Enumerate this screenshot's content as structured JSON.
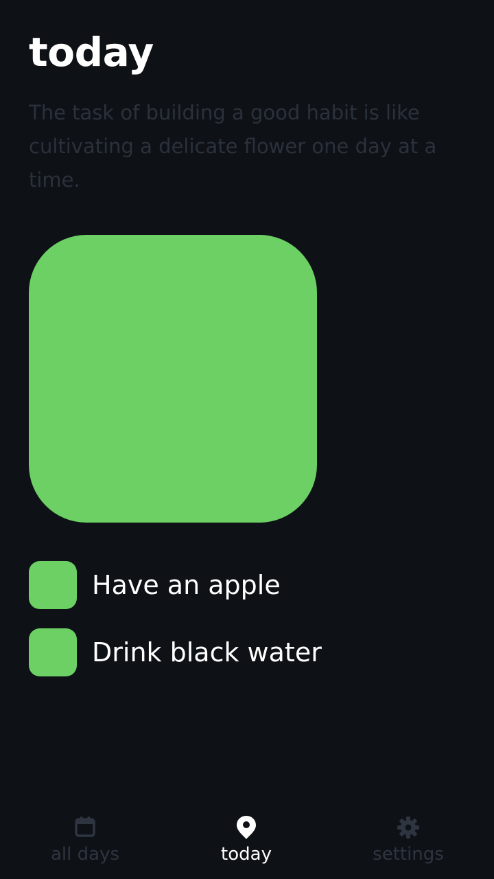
{
  "header": {
    "title": "today",
    "quote": "The task of building a good habit is like cultivating a delicate flower one day at a time."
  },
  "colors": {
    "background": "#0e1116",
    "accent": "#6cd064",
    "muted_text": "#2b313b",
    "nav_inactive": "#2f3540",
    "nav_active": "#ffffff"
  },
  "day_tile": {
    "completed": true
  },
  "habits": [
    {
      "label": "Have an apple",
      "done": true
    },
    {
      "label": "Drink black water",
      "done": true
    }
  ],
  "nav": {
    "items": [
      {
        "label": "all days",
        "icon": "calendar-icon",
        "active": false
      },
      {
        "label": "today",
        "icon": "location-pin-icon",
        "active": true
      },
      {
        "label": "settings",
        "icon": "gear-icon",
        "active": false
      }
    ]
  }
}
